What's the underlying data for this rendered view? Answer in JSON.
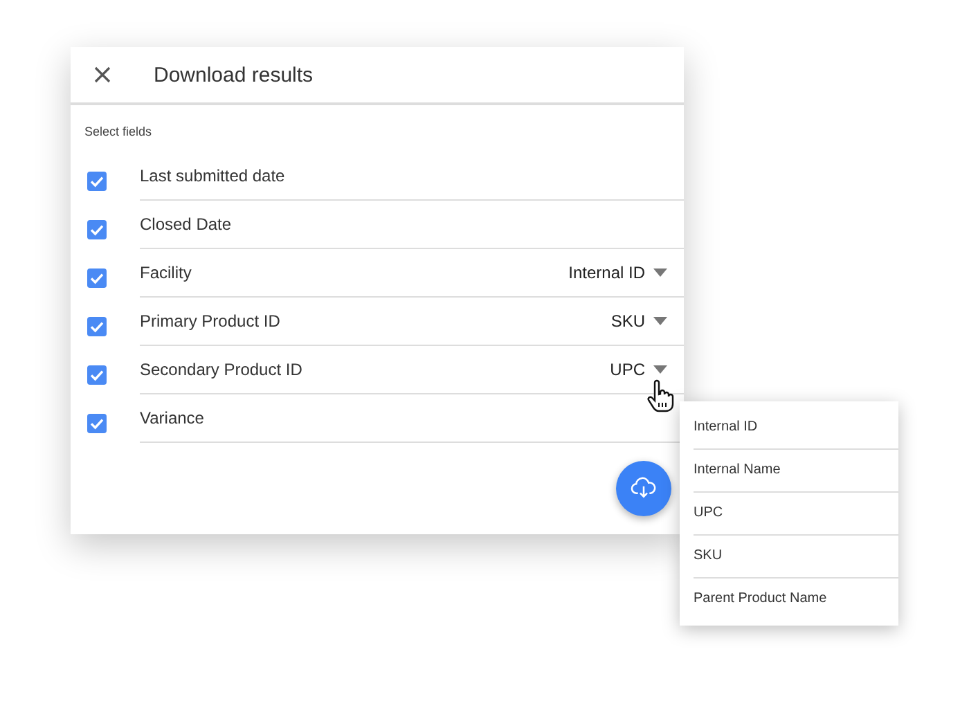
{
  "dialog": {
    "title": "Download results",
    "section_label": "Select fields",
    "fields": [
      {
        "label": "Last submitted date",
        "checked": true
      },
      {
        "label": "Closed Date",
        "checked": true
      },
      {
        "label": "Facility",
        "checked": true,
        "dropdown": "Internal ID"
      },
      {
        "label": "Primary Product ID",
        "checked": true,
        "dropdown": "SKU"
      },
      {
        "label": "Secondary Product ID",
        "checked": true,
        "dropdown": "UPC"
      },
      {
        "label": "Variance",
        "checked": true
      }
    ]
  },
  "dropdown_menu": {
    "items": [
      "Internal ID",
      "Internal Name",
      "UPC",
      "SKU",
      "Parent Product Name"
    ]
  }
}
